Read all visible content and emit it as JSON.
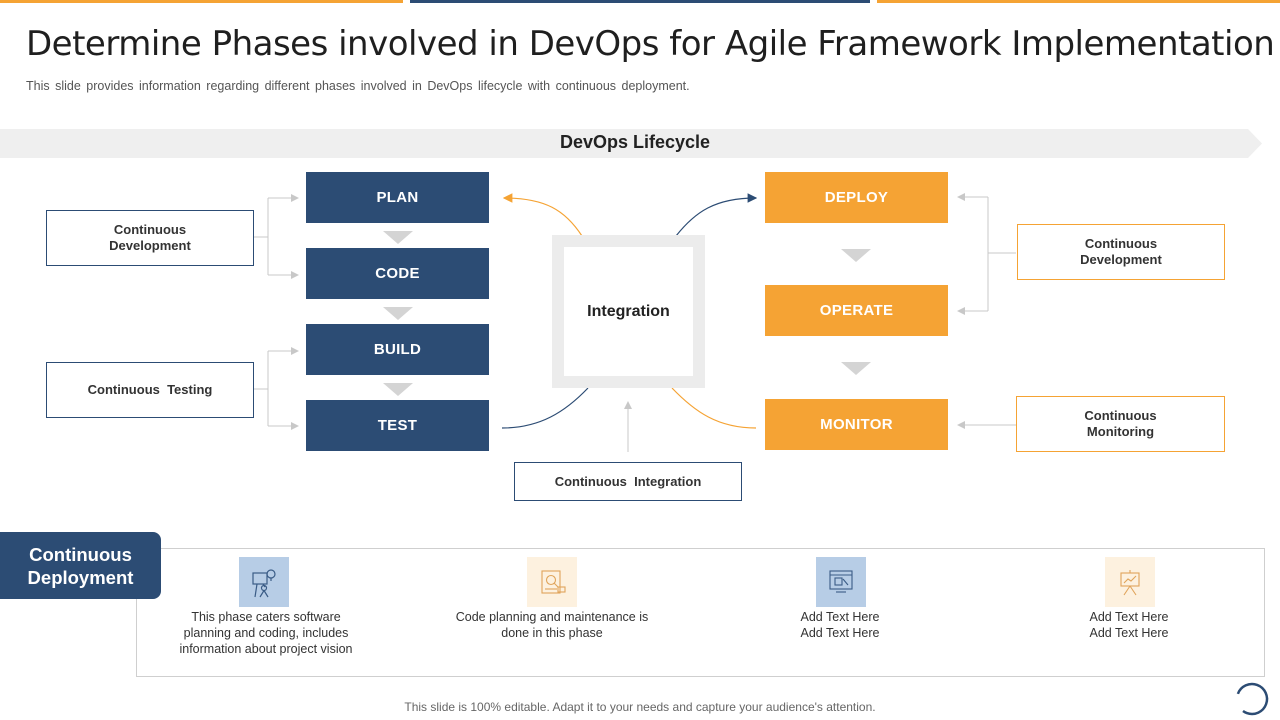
{
  "header": {
    "title": "Determine Phases involved in DevOps for Agile Framework Implementation",
    "subtitle": "This slide provides information regarding different phases involved  in DevOps lifecycle with continuous deployment."
  },
  "banner": {
    "label": "DevOps Lifecycle"
  },
  "left_phases": [
    {
      "label": "PLAN"
    },
    {
      "label": "CODE"
    },
    {
      "label": "BUILD"
    },
    {
      "label": "TEST"
    }
  ],
  "right_phases": [
    {
      "label": "DEPLOY"
    },
    {
      "label": "OPERATE"
    },
    {
      "label": "MONITOR"
    }
  ],
  "notes": {
    "left_development": "Continuous\nDevelopment",
    "left_testing": "Continuous  Testing",
    "integration": "Continuous  Integration",
    "right_development": "Continuous\nDevelopment",
    "right_monitoring": "Continuous\nMonitoring"
  },
  "integration_center": {
    "label": "Integration"
  },
  "deployment": {
    "title": "Continuous\nDeployment",
    "items": [
      {
        "icon": "bulb-board-icon",
        "text": "This phase caters software planning and coding, includes information  about project vision"
      },
      {
        "icon": "document-search-icon",
        "text": "Code planning and maintenance is done in this phase"
      },
      {
        "icon": "monitor-tools-icon",
        "text": "Add Text Here\nAdd Text Here"
      },
      {
        "icon": "easel-chart-icon",
        "text": "Add Text Here\nAdd Text Here"
      }
    ]
  },
  "footer": {
    "text": "This slide is 100% editable. Adapt it to your needs and capture your audience's attention."
  },
  "colors": {
    "blue": "#2c4c74",
    "orange": "#f5a334",
    "gray": "#d4d4d4"
  }
}
